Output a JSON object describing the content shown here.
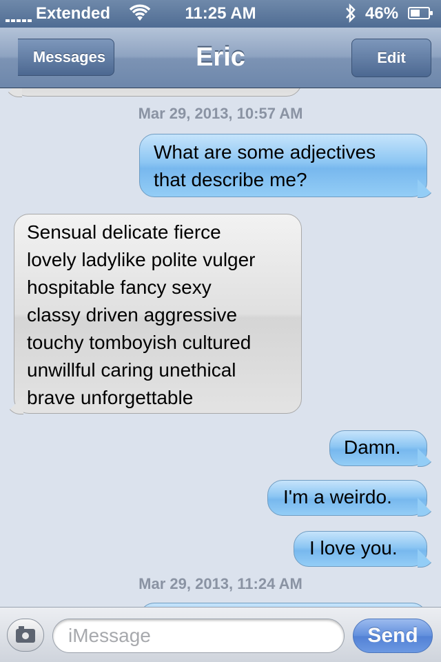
{
  "status_bar": {
    "carrier": "Extended",
    "time": "11:25 AM",
    "battery": "46%",
    "battery_level": 0.46,
    "icons": [
      "signal-dots-icon",
      "wifi-icon",
      "bluetooth-icon",
      "battery-charging-icon"
    ]
  },
  "nav": {
    "back_label": "Messages",
    "title": "Eric",
    "edit_label": "Edit"
  },
  "conversation": {
    "timestamps": [
      "Mar 29, 2013, 10:57 AM",
      "Mar 29, 2013, 11:24 AM"
    ],
    "messages": [
      {
        "direction": "outgoing",
        "text": "What are some adjectives\nthat describe me?"
      },
      {
        "direction": "incoming",
        "text": "Sensual delicate fierce\nlovely ladylike polite vulger\nhospitable fancy sexy\nclassy driven aggressive\ntouchy tomboyish cultured\nunwillful caring unethical\nbrave unforgettable"
      },
      {
        "direction": "outgoing",
        "text": "Damn."
      },
      {
        "direction": "outgoing",
        "text": "I'm a weirdo."
      },
      {
        "direction": "outgoing",
        "text": "I love you."
      }
    ]
  },
  "input_bar": {
    "placeholder": "iMessage",
    "send_label": "Send",
    "camera_icon": "camera-icon"
  },
  "colors": {
    "outgoing_bubble": "#8cc6f3",
    "incoming_bubble": "#e0e0e0",
    "background": "#dbe2ed",
    "send_button": "#4d82dc"
  }
}
